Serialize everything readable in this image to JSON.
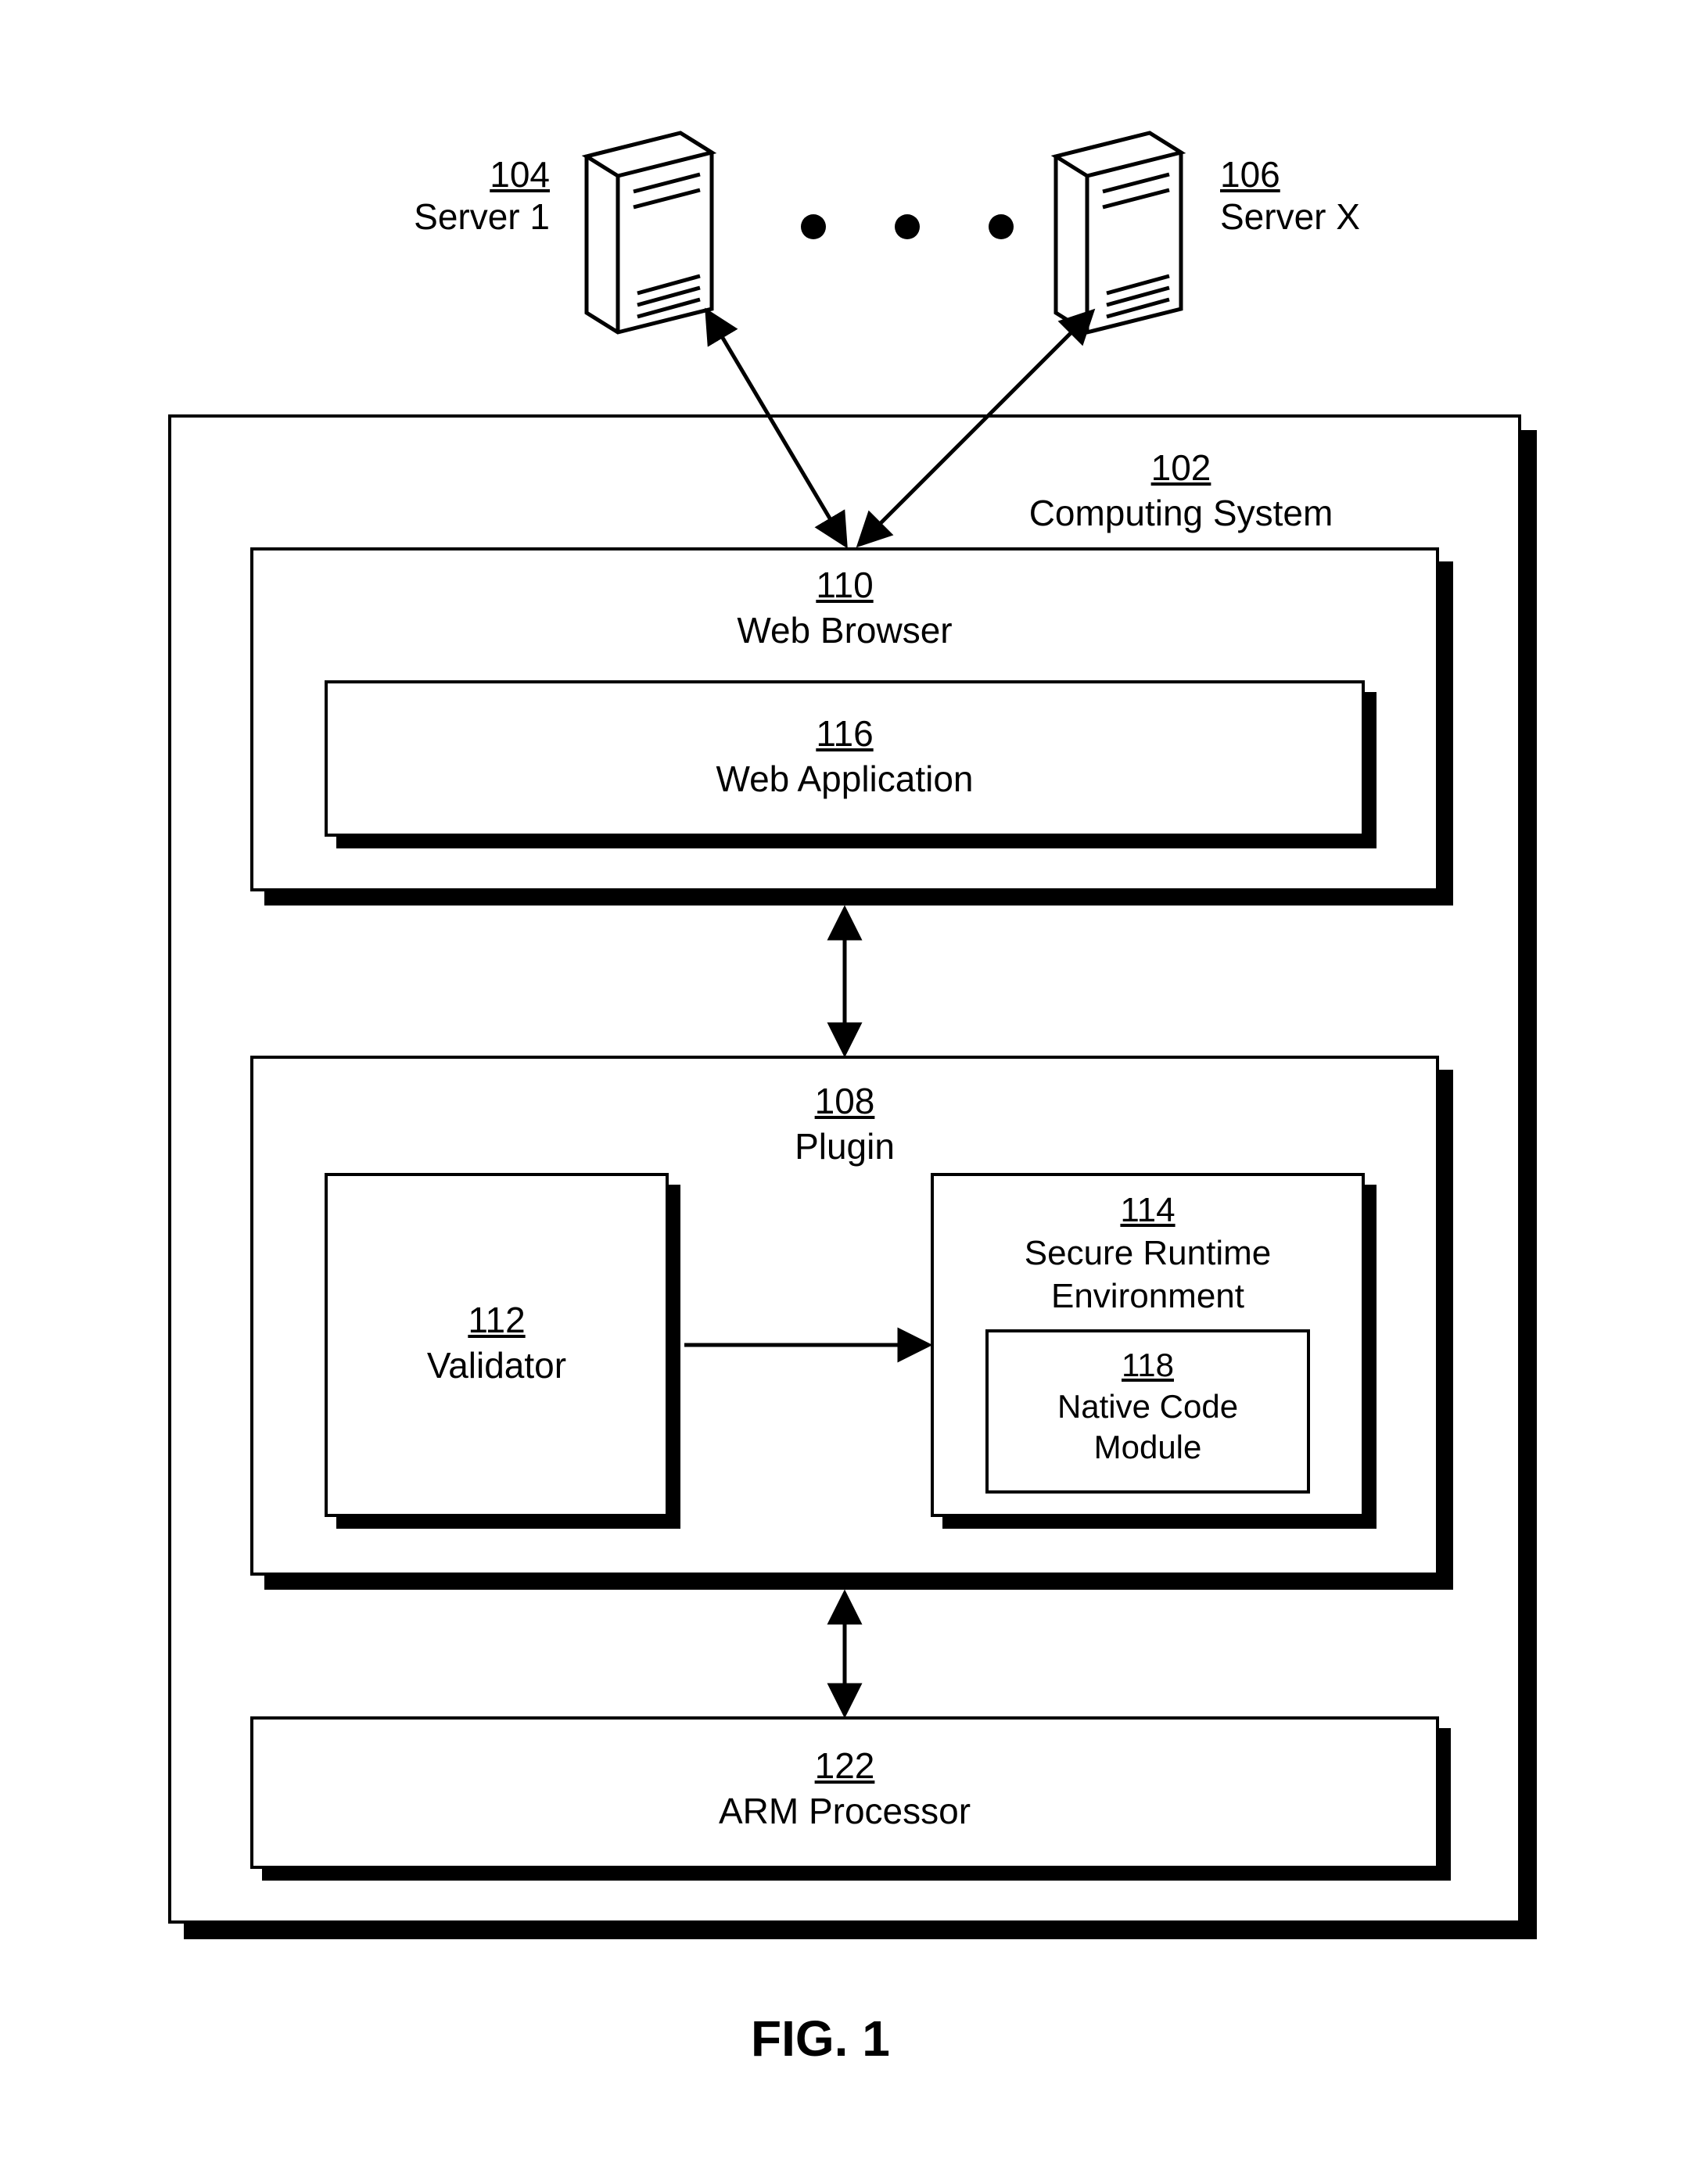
{
  "figure_caption": "FIG. 1",
  "server1": {
    "num": "104",
    "name": "Server 1"
  },
  "serverx": {
    "num": "106",
    "name": "Server X"
  },
  "computing_system": {
    "num": "102",
    "name": "Computing System"
  },
  "web_browser": {
    "num": "110",
    "name": "Web Browser"
  },
  "web_application": {
    "num": "116",
    "name": "Web Application"
  },
  "plugin": {
    "num": "108",
    "name": "Plugin"
  },
  "validator": {
    "num": "112",
    "name": "Validator"
  },
  "sre": {
    "num": "114",
    "name1": "Secure Runtime",
    "name2": "Environment"
  },
  "ncm": {
    "num": "118",
    "name1": "Native Code",
    "name2": "Module"
  },
  "arm": {
    "num": "122",
    "name": "ARM Processor"
  }
}
